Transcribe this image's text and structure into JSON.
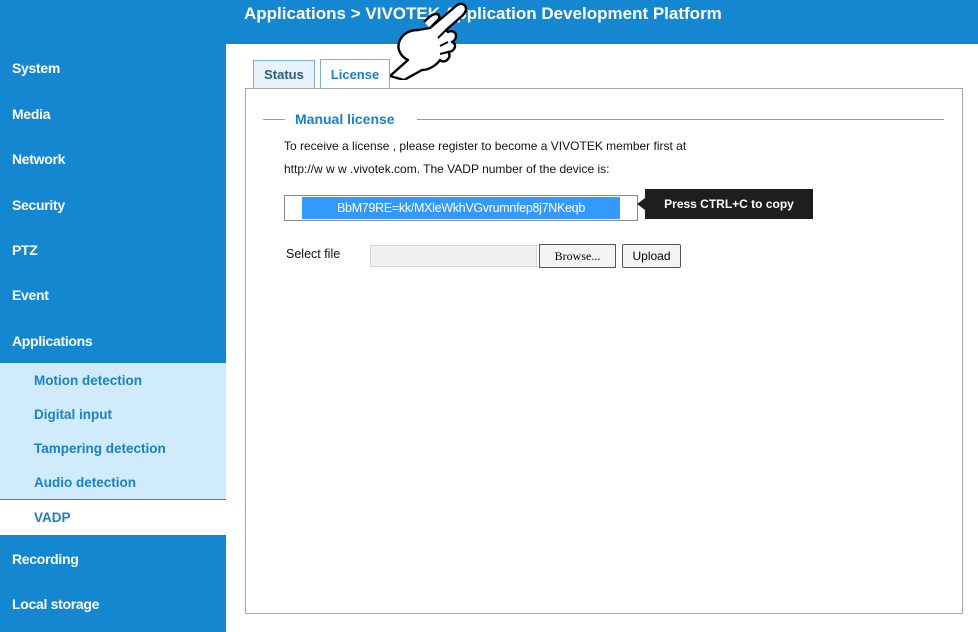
{
  "header": {
    "title": "Applications  >  VIVOTEK Application Development Platform"
  },
  "sidebar": {
    "items": [
      {
        "label": "System"
      },
      {
        "label": "Media"
      },
      {
        "label": "Network"
      },
      {
        "label": "Security"
      },
      {
        "label": "PTZ"
      },
      {
        "label": "Event"
      },
      {
        "label": "Applications"
      },
      {
        "label": "Recording"
      },
      {
        "label": "Local storage"
      }
    ],
    "sub_items": [
      {
        "label": "Motion detection"
      },
      {
        "label": "Digital input"
      },
      {
        "label": "Tampering detection"
      },
      {
        "label": "Audio detection"
      }
    ],
    "active_sub_item": "VADP"
  },
  "tabs": [
    {
      "label": "Status"
    },
    {
      "label": "License"
    }
  ],
  "license": {
    "legend": "Manual license",
    "desc_line1": "To receive a license , please register to become a VIVOTEK member first at",
    "desc_line2": "http://w w w .vivotek.com. The VADP number of the device is:",
    "vadp_number": "BbM79RE=kk/MXleWkhVGvrumnfep8j7NKeqb",
    "tooltip": "Press CTRL+C to copy",
    "select_file_label": "Select file",
    "browse_label": "Browse...",
    "upload_label": "Upload"
  },
  "colors": {
    "sidebar_bg": "#1487d0",
    "submenu_bg": "#d0ebfb",
    "accent_text": "#1a80c7"
  },
  "icons": {
    "pointer": "pointing-hand-icon"
  }
}
